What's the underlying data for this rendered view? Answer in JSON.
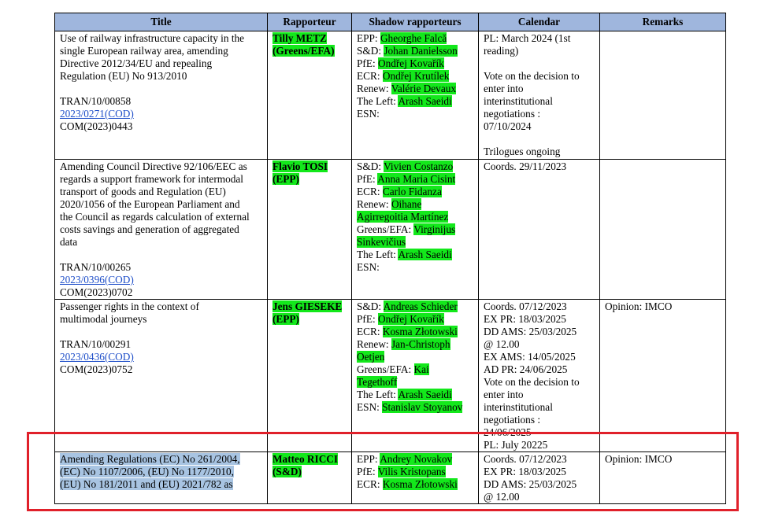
{
  "headers": {
    "title": "Title",
    "rapporteur": "Rapporteur",
    "shadow": "Shadow rapporteurs",
    "calendar": "Calendar",
    "remarks": "Remarks"
  },
  "rows": [
    {
      "title_lines": [
        "Use of railway infrastructure capacity in the",
        "single European railway area, amending",
        "Directive 2012/34/EU and repealing",
        "Regulation (EU) No 913/2010"
      ],
      "ref": "TRAN/10/00858",
      "procedure": "2023/0271(COD)",
      "com": "COM(2023)0443",
      "rapporteur_lines": [
        "Tilly METZ",
        "(Greens/EFA)"
      ],
      "shadows": [
        {
          "group": "EPP: ",
          "name": "Gheorghe Falcă"
        },
        {
          "group": "S&D: ",
          "name": "Johan Danielsson"
        },
        {
          "group": "PfE: ",
          "name": "Ondřej Kovařík"
        },
        {
          "group": "ECR: ",
          "name": "Ondřej Krutílek"
        },
        {
          "group": "Renew: ",
          "name": "Valérie Devaux"
        },
        {
          "group": "The Left: ",
          "name": "Arash Saeidi"
        },
        {
          "group": "ESN:",
          "name": ""
        }
      ],
      "calendar": [
        "PL: March 2024 (1st",
        "reading)",
        "",
        "Vote on the decision to",
        "enter into",
        "interinstitutional",
        "negotiations :",
        "07/10/2024",
        "",
        "Trilogues ongoing"
      ],
      "remarks": ""
    },
    {
      "title_lines": [
        "Amending Council Directive 92/106/EEC as",
        "regards a support framework for intermodal",
        "transport of goods and Regulation (EU)",
        "2020/1056 of the European Parliament and",
        "the Council as regards calculation of external",
        "costs savings and generation of aggregated",
        "data"
      ],
      "ref": "TRAN/10/00265",
      "procedure": "2023/0396(COD)",
      "com": "COM(2023)0702",
      "rapporteur_lines": [
        "Flavio TOSI",
        "(EPP)"
      ],
      "shadows": [
        {
          "group": "S&D: ",
          "name": "Vivien Costanzo"
        },
        {
          "group": "PfE: ",
          "name": "Anna Maria Cisint"
        },
        {
          "group": "ECR: ",
          "name": "Carlo Fidanza"
        },
        {
          "group": "Renew: ",
          "name": "Oihane"
        },
        {
          "group": "",
          "name": "Agirregoitia Martínez"
        },
        {
          "group": "Greens/EFA: ",
          "name": "Virginijus"
        },
        {
          "group": "",
          "name": "Sinkevičius"
        },
        {
          "group": "The Left: ",
          "name": "Arash Saeidi"
        },
        {
          "group": "ESN:",
          "name": ""
        }
      ],
      "calendar": [
        "Coords. 29/11/2023"
      ],
      "remarks": ""
    },
    {
      "title_lines": [
        "Passenger rights in the context of",
        "multimodal journeys"
      ],
      "ref": "TRAN/10/00291",
      "procedure": "2023/0436(COD)",
      "com": "COM(2023)0752",
      "rapporteur_lines": [
        "Jens GIESEKE",
        "(EPP)"
      ],
      "shadows": [
        {
          "group": "S&D: ",
          "name": "Andreas Schieder"
        },
        {
          "group": "PfE: ",
          "name": "Ondřej Kovařík"
        },
        {
          "group": "ECR: ",
          "name": "Kosma Złotowski"
        },
        {
          "group": "Renew: ",
          "name": "Jan-Christoph"
        },
        {
          "group": "",
          "name": "Oetjen"
        },
        {
          "group": "Greens/EFA: ",
          "name": "Kai"
        },
        {
          "group": "",
          "name": "Tegethoff"
        },
        {
          "group": "The Left: ",
          "name": "Arash Saeidi"
        },
        {
          "group": "ESN: ",
          "name": "Stanislav Stoyanov"
        }
      ],
      "calendar": [
        "Coords. 07/12/2023",
        "EX PR: 18/03/2025",
        "DD AMS: 25/03/2025",
        "@ 12.00",
        "EX AMS: 14/05/2025",
        "AD PR: 24/06/2025",
        "Vote on the decision to",
        "enter into",
        "interinstitutional",
        "negotiations :",
        "24/06/2025",
        "PL: July 20225"
      ],
      "remarks": "Opinion: IMCO"
    },
    {
      "title_lines": [
        "Amending Regulations (EC) No 261/2004,",
        "(EC) No 1107/2006, (EU) No 1177/2010,",
        "(EU) No 181/2011 and (EU) 2021/782 as"
      ],
      "rapporteur_lines": [
        "Matteo RICCI",
        "(S&D)"
      ],
      "shadows": [
        {
          "group": "EPP: ",
          "name": "Andrey Novakov"
        },
        {
          "group": "PfE: ",
          "name": "Vilis Kristopans"
        },
        {
          "group": "ECR: ",
          "name": "Kosma Złotowski"
        }
      ],
      "calendar": [
        "Coords. 07/12/2023",
        "EX PR: 18/03/2025",
        "DD AMS: 25/03/2025",
        "@ 12.00"
      ],
      "remarks": "Opinion: IMCO"
    }
  ]
}
